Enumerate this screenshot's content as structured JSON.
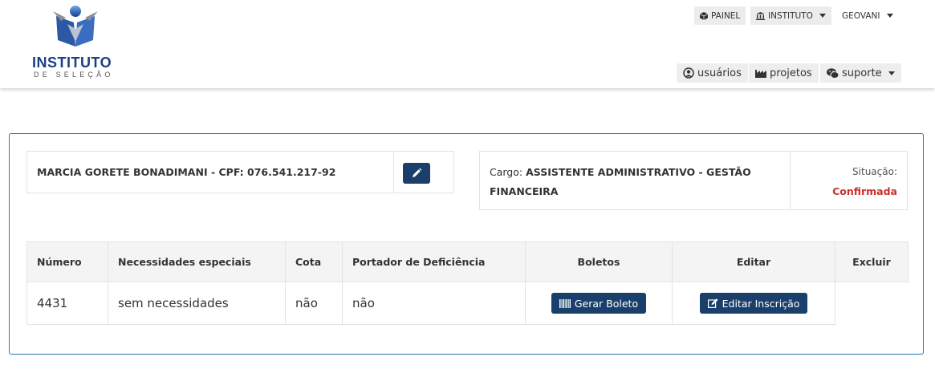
{
  "brand": {
    "name": "INSTITUTO",
    "subtitle": "DE SELEÇÃO"
  },
  "topbar": {
    "painel": "PAINEL",
    "instituto": "INSTITUTO",
    "user": "GEOVANI"
  },
  "nav": {
    "usuarios": "usuários",
    "projetos": "projetos",
    "suporte": "suporte"
  },
  "candidate": {
    "name_line": "MARCIA GORETE BONADIMANI - CPF: 076.541.217-92"
  },
  "position": {
    "label": "Cargo: ",
    "value": "ASSISTENTE ADMINISTRATIVO - GESTÃO FINANCEIRA",
    "status_label": "Situação:",
    "status_value": "Confirmada",
    "status_color": "#c9302c"
  },
  "table": {
    "headers": [
      "Número",
      "Necessidades especiais",
      "Cota",
      "Portador de Deficiência",
      "Boletos",
      "Editar",
      "Excluir"
    ],
    "rows": [
      {
        "numero": "4431",
        "necessidades": "sem necessidades",
        "cota": "não",
        "deficiencia": "não",
        "boleto_button": "Gerar Boleto",
        "editar_button": "Editar Inscrição"
      }
    ]
  },
  "colors": {
    "primary": "#1a3f6a",
    "panel_border": "#2a7ab0",
    "brand_blue": "#1d3f86"
  }
}
